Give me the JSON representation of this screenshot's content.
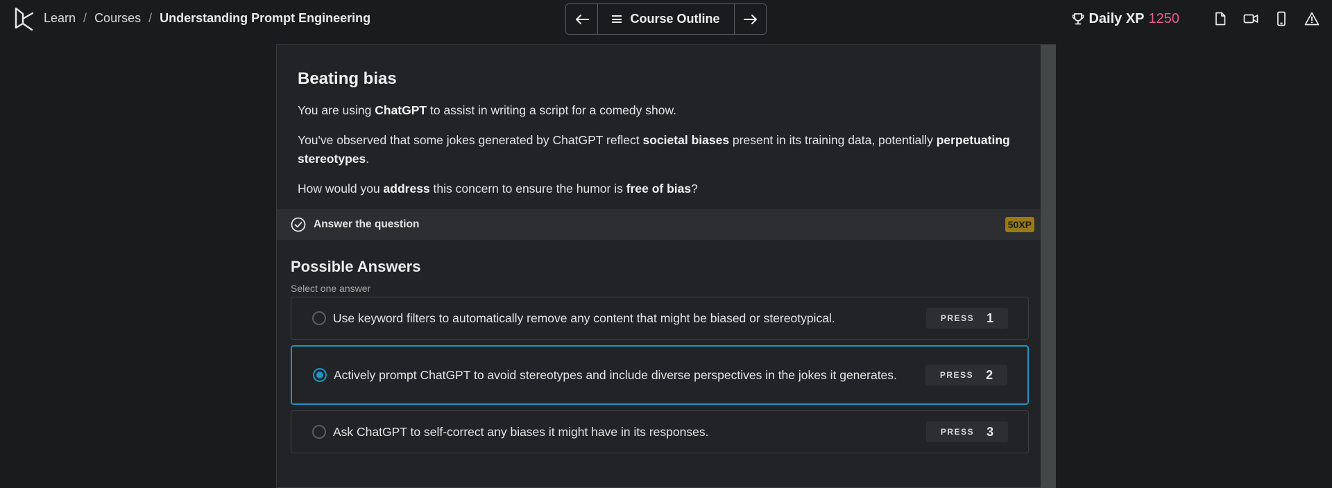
{
  "header": {
    "breadcrumb": [
      "Learn",
      "Courses",
      "Understanding Prompt Engineering"
    ],
    "separator": "/",
    "course_outline_label": "Course Outline",
    "xp_label": "Daily XP",
    "xp_value": "1250",
    "icons": [
      "trophy-icon",
      "document-icon",
      "video-icon",
      "mobile-icon",
      "warning-icon"
    ]
  },
  "exercise": {
    "title": "Beating bias",
    "answer_bar_label": "Answer the question",
    "xp_badge": "50XP"
  },
  "answers": {
    "title": "Possible Answers",
    "subtitle": "Select one answer",
    "press_label": "PRESS",
    "options": [
      {
        "text": "Use keyword filters to automatically remove any content that might be biased or stereotypical.",
        "key": "1",
        "selected": false
      },
      {
        "text": "Actively prompt ChatGPT to avoid stereotypes and include diverse perspectives in the jokes it generates.",
        "key": "2",
        "selected": true
      },
      {
        "text": "Ask ChatGPT to self-correct any biases it might have in its responses.",
        "key": "3",
        "selected": false
      }
    ]
  },
  "colors": {
    "background": "#1a1b1d",
    "panel": "#222326",
    "accent_blue": "#1a96c9",
    "xp_pink": "#e85c8e",
    "xp_badge": "#9a7a14"
  }
}
